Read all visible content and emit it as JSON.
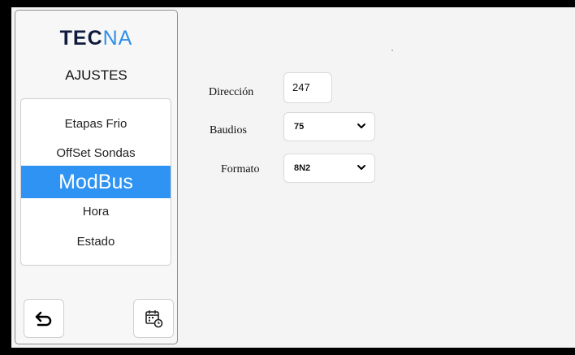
{
  "colors": {
    "accent": "#2e93f3",
    "logo_dark": "#0f1a3c",
    "logo_light": "#2f8ee6"
  },
  "sidebar": {
    "logo_part1": "TEC",
    "logo_part2": "NA",
    "title": "AJUSTES",
    "menu": [
      {
        "label": "Etapas Frio",
        "selected": false
      },
      {
        "label": "OffSet Sondas",
        "selected": false
      },
      {
        "label": "ModBus",
        "selected": true
      },
      {
        "label": "Hora",
        "selected": false
      },
      {
        "label": "Estado",
        "selected": false
      }
    ],
    "back_icon": "back-arrow-icon",
    "calendar_icon": "calendar-clock-icon"
  },
  "form": {
    "direccion": {
      "label": "Dirección",
      "value": "247"
    },
    "baudios": {
      "label": "Baudios",
      "value": "75"
    },
    "formato": {
      "label": "Formato",
      "value": "8N2"
    }
  }
}
